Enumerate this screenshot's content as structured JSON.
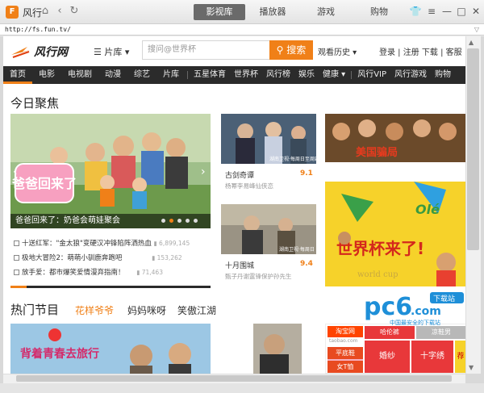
{
  "titlebar": {
    "app_name": "风行",
    "tabs": [
      "影视库",
      "播放器",
      "游戏",
      "购物"
    ],
    "active_tab": 0
  },
  "address": {
    "url": "http://fs.fun.tv/",
    "end_marker": "▽"
  },
  "site": {
    "logo_text": "风行网",
    "library_label": "片库",
    "search_placeholder": "搜问@世界杯",
    "search_button": "搜索",
    "history_label": "观看历史",
    "top_links": "登录 | 注册   下载 | 客服",
    "nav": [
      "首页",
      "电影",
      "电视剧",
      "动漫",
      "综艺",
      "片库",
      "五星体育",
      "世界杯",
      "风行榜",
      "娱乐",
      "健康",
      "风行VIP",
      "风行游戏",
      "购物"
    ]
  },
  "focus": {
    "title": "今日聚焦",
    "hero_caption": "爸爸回来了：奶爸会萌娃聚会",
    "hero_overlay": "爸爸回来了",
    "news": [
      {
        "text": "十送红军：\"金太狼\"变硬汉冲锋陷阵洒热血",
        "count": "6,899,145"
      },
      {
        "text": "极地大冒险2：萌萌小驯鹿奔跑吧",
        "count": "153,262"
      },
      {
        "text": "放手爱：都市爆笑爱情漫弃指南！",
        "count": "71,463"
      }
    ],
    "cards": [
      {
        "title": "古剑奇谭",
        "score": "9.1",
        "desc": "杨幂李易峰仙侠恋",
        "img_label": "湖南卫视·每周日至周四"
      },
      {
        "title": "十月围城",
        "score": "9.4",
        "desc": "甄子丹谢霆锋保护孙先生",
        "img_label": "湖南卫视·每周日"
      }
    ],
    "poster_top_text": "美国骗局",
    "poster_big_text": "世界杯来了!",
    "poster_ole": "Olé",
    "poster_world": "world cup"
  },
  "hot": {
    "title": "热门节目",
    "tabs": [
      "花样爷爷",
      "妈妈咪呀",
      "笑傲江湖"
    ],
    "active": 0,
    "thumb_text": "背着青春去旅行",
    "shop_label": "淘宝网",
    "shop_sub": "taobao.com",
    "shop_tiles": [
      "哈伦裤",
      "凉鞋男",
      "平底鞋",
      "女T恤",
      "婚纱",
      "十字绣",
      "荐"
    ]
  },
  "watermark": {
    "main": "pc6",
    "domain": ".com",
    "badge": "下载站",
    "slogan": "中国最安全的下载站"
  },
  "colors": {
    "accent": "#f08018",
    "nav_bg": "#2b2b2b"
  }
}
